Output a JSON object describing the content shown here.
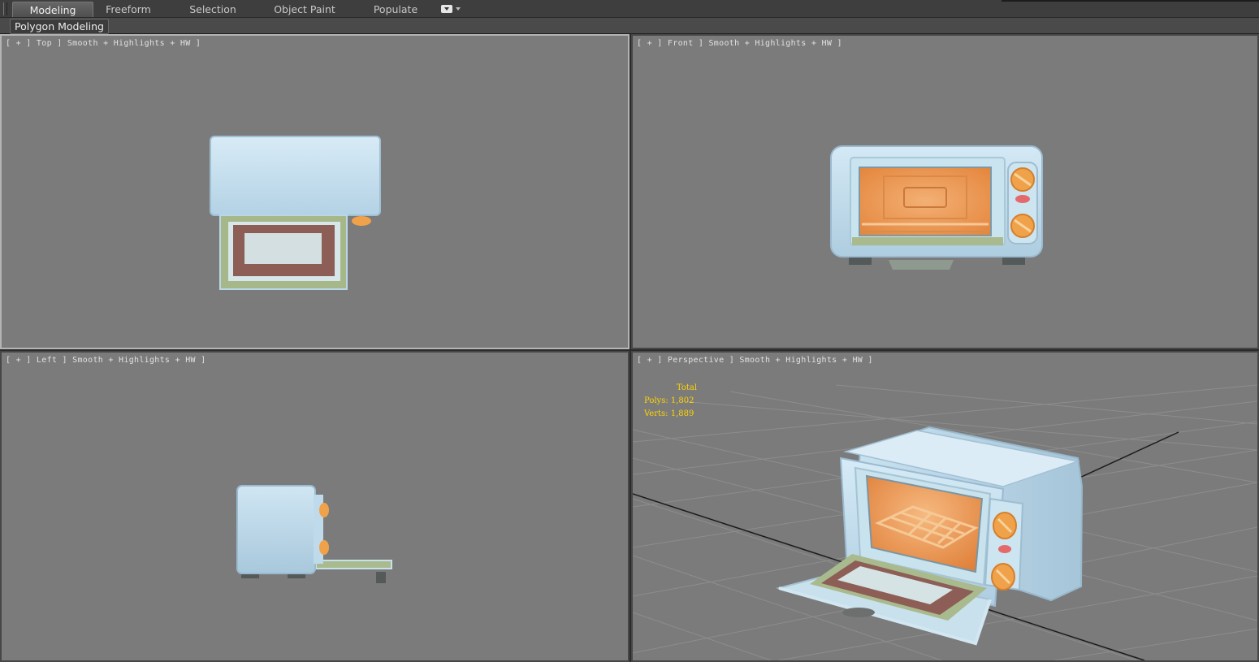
{
  "ribbon": {
    "tabs": [
      {
        "label": "Modeling",
        "active": true
      },
      {
        "label": "Freeform",
        "active": false
      },
      {
        "label": "Selection",
        "active": false
      },
      {
        "label": "Object Paint",
        "active": false
      },
      {
        "label": "Populate",
        "active": false
      }
    ],
    "toggle_icon": "ribbon-minimize-icon",
    "panel_label": "Polygon Modeling"
  },
  "viewports": {
    "top": {
      "label": "[ + ] Top ] Smooth + Highlights + HW ]"
    },
    "front": {
      "label": "[ + ] Front ] Smooth + Highlights + HW ]"
    },
    "left": {
      "label": "[ + ] Left ] Smooth + Highlights + HW ]"
    },
    "perspective": {
      "label": "[ + ] Perspective ] Smooth + Highlights + HW ]"
    }
  },
  "stats": {
    "total_label": "Total",
    "polys": "Polys: 1,802",
    "verts": "Verts: 1,889"
  },
  "colors": {
    "viewport_bg": "#7b7b7b",
    "active_border": "#b4b4b4",
    "stats_text": "#ffd500",
    "oven_body": "#bcd9ea",
    "oven_interior": "#f29a4c",
    "knob": "#f0a24a"
  }
}
